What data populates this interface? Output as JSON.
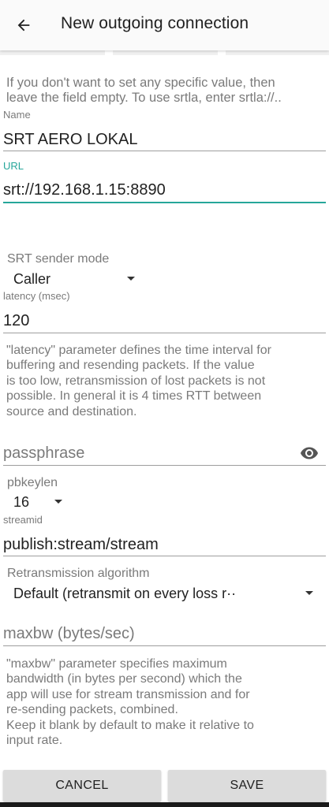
{
  "appbar": {
    "title": "New outgoing connection",
    "back_icon": "arrow-left-icon"
  },
  "intro_hint": {
    "line1": "If you don't want to set any specific value, then",
    "line2": "leave the field empty. To use srtla, enter srtla://.."
  },
  "name_field": {
    "label": "Name",
    "value": "SRT AERO LOKAL"
  },
  "url_field": {
    "label": "URL",
    "value": "srt://192.168.1.15:8890"
  },
  "sender_mode": {
    "title": "SRT sender mode",
    "value": "Caller"
  },
  "latency_field": {
    "label": "latency (msec)",
    "value": "120"
  },
  "latency_desc": {
    "line1": "\"latency\" parameter defines the time interval for",
    "line2": "buffering and resending packets. If the value",
    "line3": "is too low, retransmission of lost packets is not",
    "line4": "possible. In general it is 4 times RTT between",
    "line5": "source and destination."
  },
  "passphrase_field": {
    "placeholder": "passphrase",
    "toggle_icon": "eye-icon"
  },
  "pbkeylen": {
    "title": "pbkeylen",
    "value": "16"
  },
  "streamid_field": {
    "label": "streamid",
    "value": "publish:stream/stream"
  },
  "retransmission": {
    "title": "Retransmission algorithm",
    "value": "Default (retransmit on every loss r··"
  },
  "maxbw_field": {
    "placeholder": "maxbw (bytes/sec)"
  },
  "maxbw_desc": {
    "line1": "\"maxbw\" parameter specifies maximum",
    "line2": "bandwidth (in bytes per second) which the",
    "line3": "app will use for stream transmission and for",
    "line4": "re-sending packets, combined.",
    "line5": "Keep it blank by default to make it relative to",
    "line6": "input rate."
  },
  "buttons": {
    "cancel": "CANCEL",
    "save": "SAVE"
  },
  "colors": {
    "accent": "#26a69a",
    "hint_text": "#7a7a7a",
    "button_bg": "#dcdcdc"
  }
}
